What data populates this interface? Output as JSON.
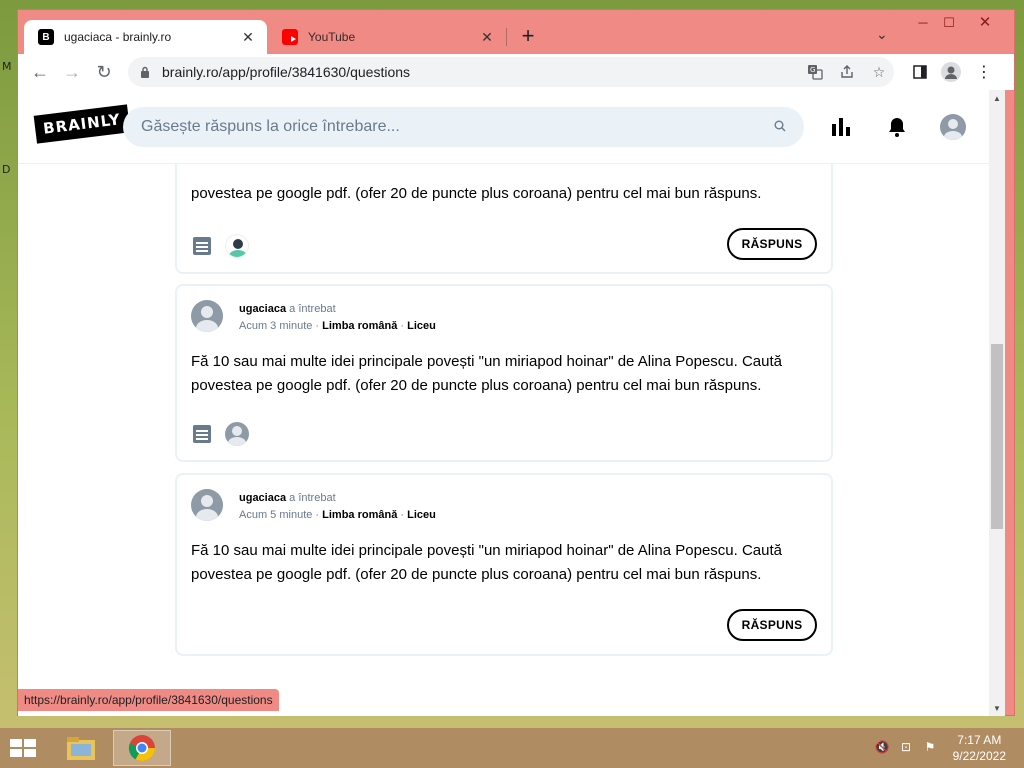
{
  "browser": {
    "tabs": [
      {
        "title": "ugaciaca - brainly.ro",
        "active": true,
        "favicon": "brainly-favicon"
      },
      {
        "title": "YouTube",
        "active": false,
        "favicon": "youtube-favicon"
      }
    ],
    "url": "brainly.ro/app/profile/3841630/questions",
    "status_url": "https://brainly.ro/app/profile/3841630/questions"
  },
  "site": {
    "logo": "BRAINLY",
    "search_placeholder": "Găsește răspuns la orice întrebare..."
  },
  "questions": [
    {
      "line2": "povestea pe google pdf. (ofer 20 de puncte plus coroana) pentru cel mai bun răspuns.",
      "answer_label": "RĂSPUNS"
    },
    {
      "user": "ugaciaca",
      "action": "a întrebat",
      "time": "Acum 3 minute",
      "subject": "Limba română",
      "level": "Liceu",
      "line1": "Fă 10 sau mai multe idei principale povești \"un miriapod hoinar\" de Alina Popescu. Caută",
      "line2": "povestea pe google pdf. (ofer 20 de puncte plus coroana) pentru cel mai bun răspuns."
    },
    {
      "user": "ugaciaca",
      "action": "a întrebat",
      "time": "Acum 5 minute",
      "subject": "Limba română",
      "level": "Liceu",
      "line1": "Fă 10 sau mai multe idei principale povești \"un miriapod hoinar\" de Alina Popescu. Caută",
      "line2": "povestea pe google pdf. (ofer 20 de puncte plus coroana) pentru cel mai bun răspuns.",
      "answer_label": "RĂSPUNS"
    }
  ],
  "taskbar": {
    "time": "7:17 AM",
    "date": "9/22/2022"
  },
  "colors": {
    "window_frame": "#f08a85",
    "brainly_search_bg": "#ebf2f7",
    "brainly_gray": "#687b8c"
  }
}
